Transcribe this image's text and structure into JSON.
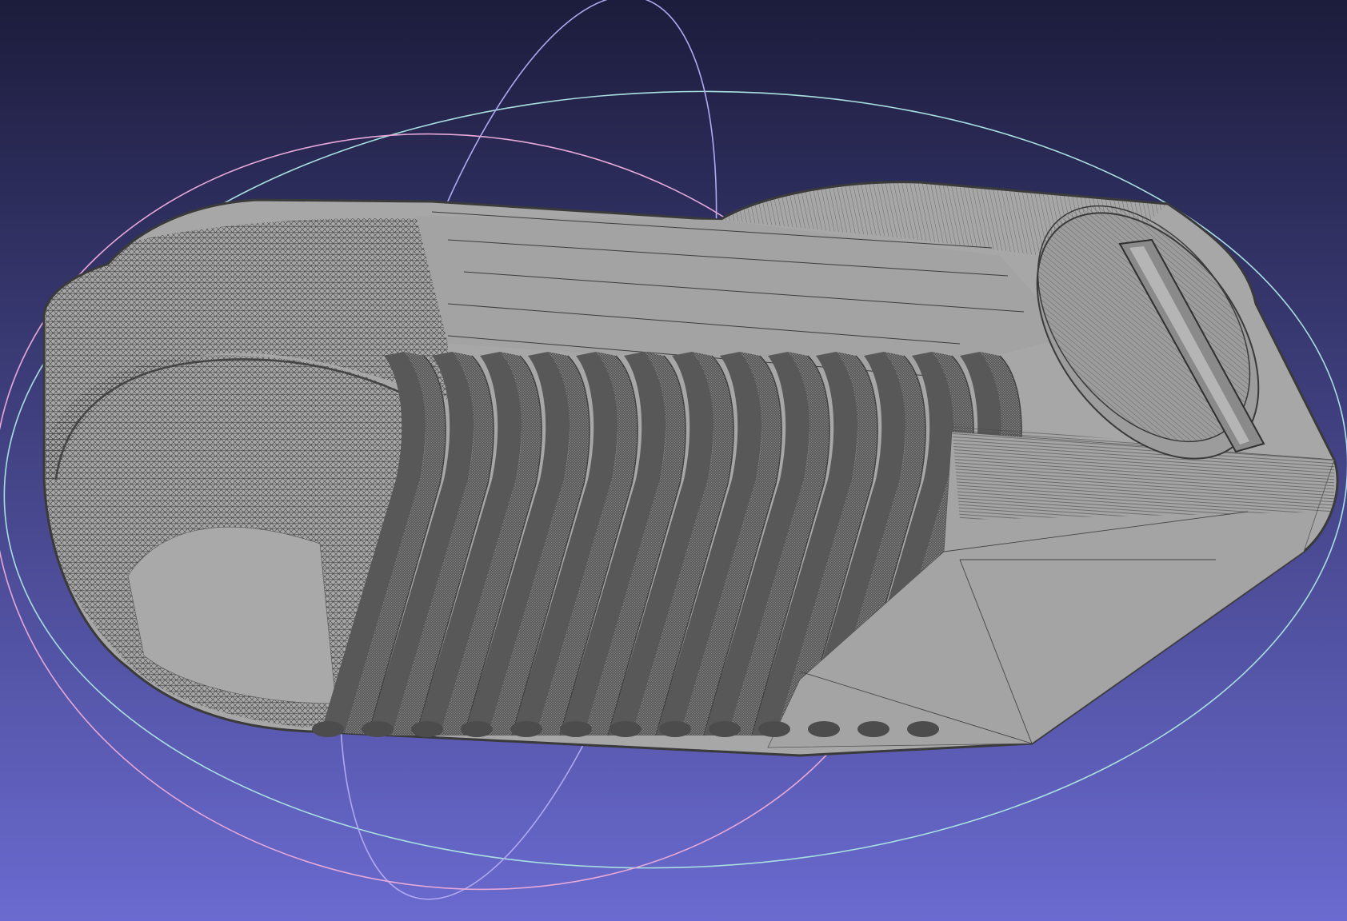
{
  "viewer": {
    "mode": "3d-mesh-view",
    "render_style": "flat-lines",
    "background_colors": {
      "top": "#1c1c3c",
      "bottom": "#6a6ad0"
    },
    "mesh_colors": {
      "face": "#a7a7a7",
      "face_dark": "#8e8e8e",
      "edge": "#404040",
      "groove": "#585858"
    },
    "trackball_colors": {
      "horizontal": "#a8e0e0",
      "vertical": "#b0a8f0",
      "tilted": "#e6a8d8"
    },
    "model": {
      "name": "",
      "groove_count": 13
    }
  }
}
